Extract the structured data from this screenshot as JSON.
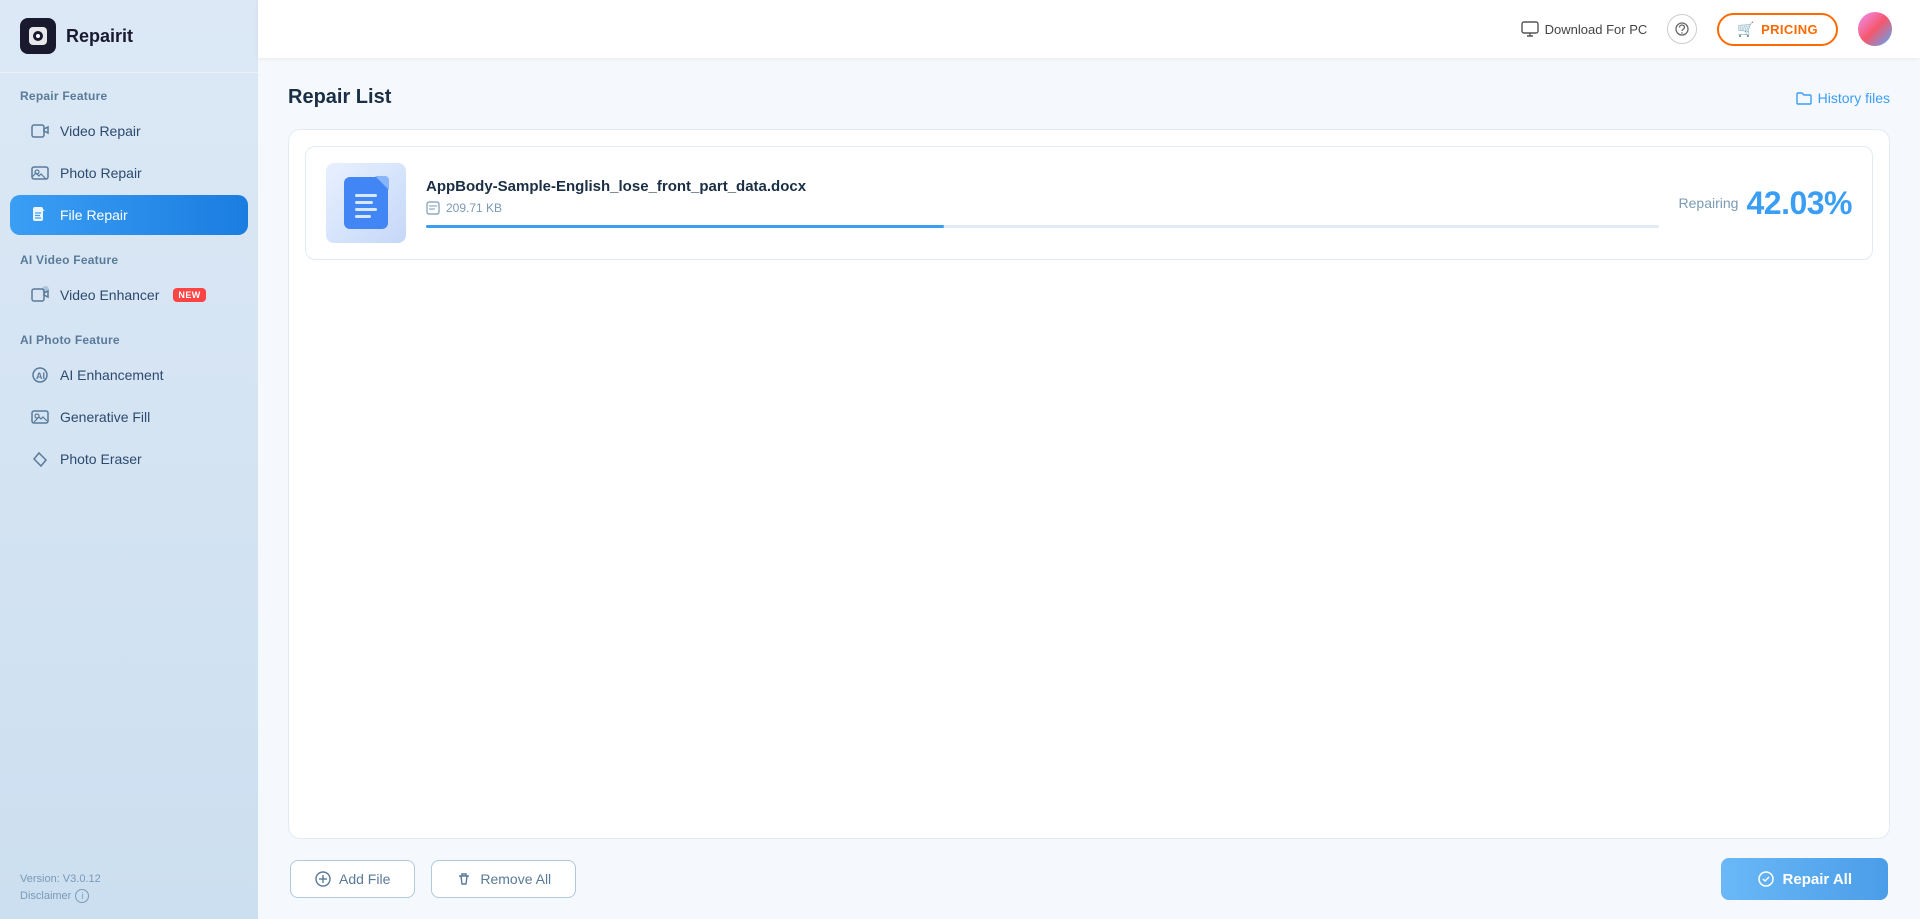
{
  "app": {
    "name": "Repairit"
  },
  "topbar": {
    "download_label": "Download For PC",
    "pricing_label": "PRICING",
    "history_label": "History files"
  },
  "sidebar": {
    "repair_feature_label": "Repair Feature",
    "items_repair": [
      {
        "id": "video-repair",
        "label": "Video Repair",
        "icon": "▶"
      },
      {
        "id": "photo-repair",
        "label": "Photo Repair",
        "icon": "🖼"
      },
      {
        "id": "file-repair",
        "label": "File Repair",
        "icon": "📄",
        "active": true
      }
    ],
    "ai_video_label": "AI Video Feature",
    "items_ai_video": [
      {
        "id": "video-enhancer",
        "label": "Video Enhancer",
        "icon": "🎞",
        "new": true
      }
    ],
    "ai_photo_label": "AI Photo Feature",
    "items_ai_photo": [
      {
        "id": "ai-enhancement",
        "label": "AI Enhancement",
        "icon": "✨"
      },
      {
        "id": "generative-fill",
        "label": "Generative Fill",
        "icon": "🔷"
      },
      {
        "id": "photo-eraser",
        "label": "Photo Eraser",
        "icon": "◇"
      }
    ],
    "version": "Version: V3.0.12",
    "disclaimer": "Disclaimer"
  },
  "main": {
    "repair_list_title": "Repair List",
    "file": {
      "name": "AppBody-Sample-English_lose_front_part_data.docx",
      "size": "209.71 KB",
      "progress_pct": 42.03,
      "progress_label": "42.03%",
      "status_label": "Repairing"
    },
    "add_file_label": "Add File",
    "remove_all_label": "Remove All",
    "repair_all_label": "Repair All",
    "new_badge": "NEW"
  }
}
